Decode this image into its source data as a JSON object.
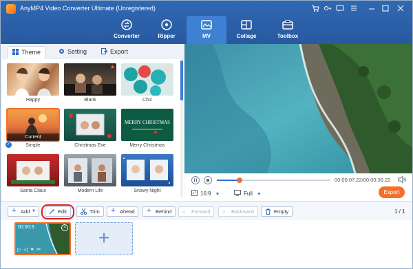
{
  "app": {
    "title": "AnyMP4 Video Converter Ultimate (Unregistered)"
  },
  "main_tabs": [
    {
      "label": "Converter",
      "icon": "converter-icon"
    },
    {
      "label": "Ripper",
      "icon": "ripper-icon"
    },
    {
      "label": "MV",
      "icon": "mv-icon",
      "active": true
    },
    {
      "label": "Collage",
      "icon": "collage-icon"
    },
    {
      "label": "Toolbox",
      "icon": "toolbox-icon"
    }
  ],
  "sub_tabs": [
    {
      "label": "Theme",
      "active": true
    },
    {
      "label": "Setting"
    },
    {
      "label": "Export"
    }
  ],
  "themes": [
    {
      "label": "Happy"
    },
    {
      "label": "Blank"
    },
    {
      "label": "Chic"
    },
    {
      "label": "Simple",
      "selected": true,
      "badge": "Current"
    },
    {
      "label": "Christmas Eve"
    },
    {
      "label": "Merry Christmas",
      "thumb_text": "MERRY CHRISTMAS"
    },
    {
      "label": "Santa Claus"
    },
    {
      "label": "Modern Life"
    },
    {
      "label": "Snowy Night"
    }
  ],
  "player": {
    "time": "00:00:07.22/00:00:36.22",
    "progress": 0.2,
    "aspect_ratio": "16:9",
    "view_mode": "Full",
    "export_label": "Export"
  },
  "toolbar": {
    "add": "Add",
    "edit": "Edit",
    "trim": "Trim",
    "ahead": "Ahead",
    "behind": "Behind",
    "forward": "Forward",
    "backward": "Backward",
    "empty": "Empty",
    "page_current": "1",
    "page_total": "1"
  },
  "clip": {
    "duration": "00:00:3"
  },
  "colors": {
    "accent": "#f3702a",
    "brand": "#2c6bbd",
    "highlight": "#e02020"
  }
}
